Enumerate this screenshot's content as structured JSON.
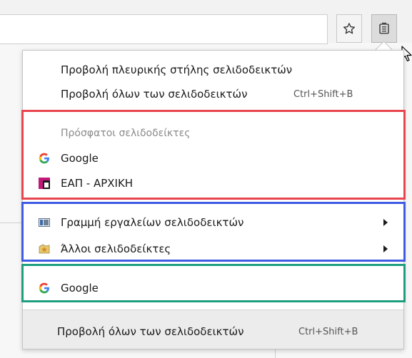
{
  "toolbar": {
    "star_icon": "star-icon",
    "library_icon": "library-icon"
  },
  "menu": {
    "view_sidebar": {
      "label": "Προβολή πλευρικής στήλης σελιδοδεικτών"
    },
    "show_all_top": {
      "label": "Προβολή όλων των σελιδοδεικτών",
      "shortcut": "Ctrl+Shift+B"
    },
    "recent_header": "Πρόσφατοι σελιδοδείκτες",
    "recent_items": [
      {
        "label": "Google",
        "icon": "google-icon"
      },
      {
        "label": "ΕΑΠ - ΑΡΧΙΚΗ",
        "icon": "eap-icon"
      }
    ],
    "folders": [
      {
        "label": "Γραμμή εργαλείων σελιδοδεικτών",
        "icon": "toolbar-folder-icon"
      },
      {
        "label": "Άλλοι σελιδοδείκτες",
        "icon": "other-bookmarks-icon"
      }
    ],
    "bookmarks": [
      {
        "label": "Google",
        "icon": "google-icon"
      }
    ],
    "footer": {
      "label": "Προβολή όλων των σελιδοδεικτών",
      "shortcut": "Ctrl+Shift+B"
    }
  },
  "highlight_colors": {
    "recent": "#e8454f",
    "folders": "#3f5be3",
    "bookmarks": "#1f9e7f"
  }
}
